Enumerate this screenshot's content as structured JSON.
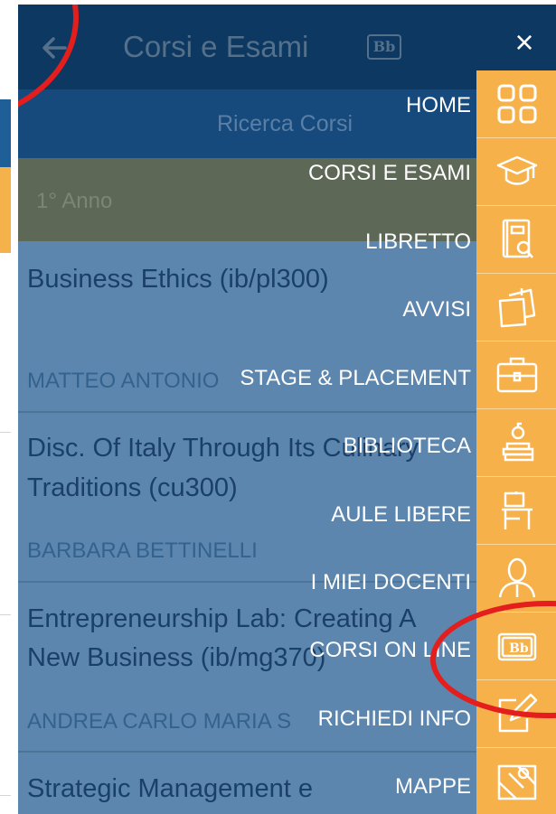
{
  "header": {
    "title": "Corsi e Esami",
    "logo_text": "Bb",
    "close_glyph": "×"
  },
  "search": {
    "label": "Ricerca Corsi"
  },
  "year": {
    "label": "1° Anno"
  },
  "courses": [
    {
      "title_lines": [
        "Business Ethics (ib/pl300)"
      ],
      "teacher": "MATTEO ANTONIO"
    },
    {
      "title_lines": [
        "Disc. Of Italy Through Its Culinary",
        "Traditions (cu300)"
      ],
      "teacher": "BARBARA BETTINELLI"
    },
    {
      "title_lines": [
        "Entrepreneurship Lab: Creating A",
        "New Business (ib/mg370)"
      ],
      "teacher": "ANDREA CARLO MARIA S"
    },
    {
      "title_lines": [
        "Strategic Management e"
      ],
      "teacher": ""
    }
  ],
  "menu": {
    "items": [
      {
        "label": "HOME",
        "icon": "grid-icon"
      },
      {
        "label": "CORSI E ESAMI",
        "icon": "graduation-cap-icon"
      },
      {
        "label": "LIBRETTO",
        "icon": "booklet-search-icon"
      },
      {
        "label": "AVVISI",
        "icon": "notes-icon"
      },
      {
        "label": "STAGE & PLACEMENT",
        "icon": "briefcase-icon"
      },
      {
        "label": "BIBLIOTECA",
        "icon": "library-icon"
      },
      {
        "label": "AULE LIBERE",
        "icon": "classroom-desk-icon"
      },
      {
        "label": "I MIEI DOCENTI",
        "icon": "teacher-icon"
      },
      {
        "label": "CORSI ON LINE",
        "icon": "blackboard-icon"
      },
      {
        "label": "RICHIEDI INFO",
        "icon": "edit-note-icon"
      },
      {
        "label": "MAPPE",
        "icon": "map-icon"
      }
    ]
  },
  "colors": {
    "accent_orange": "#f6b14a",
    "header_navy": "#0c3861",
    "overlay_blue": "#5c86ad",
    "annotation_red": "#e41d1d"
  }
}
